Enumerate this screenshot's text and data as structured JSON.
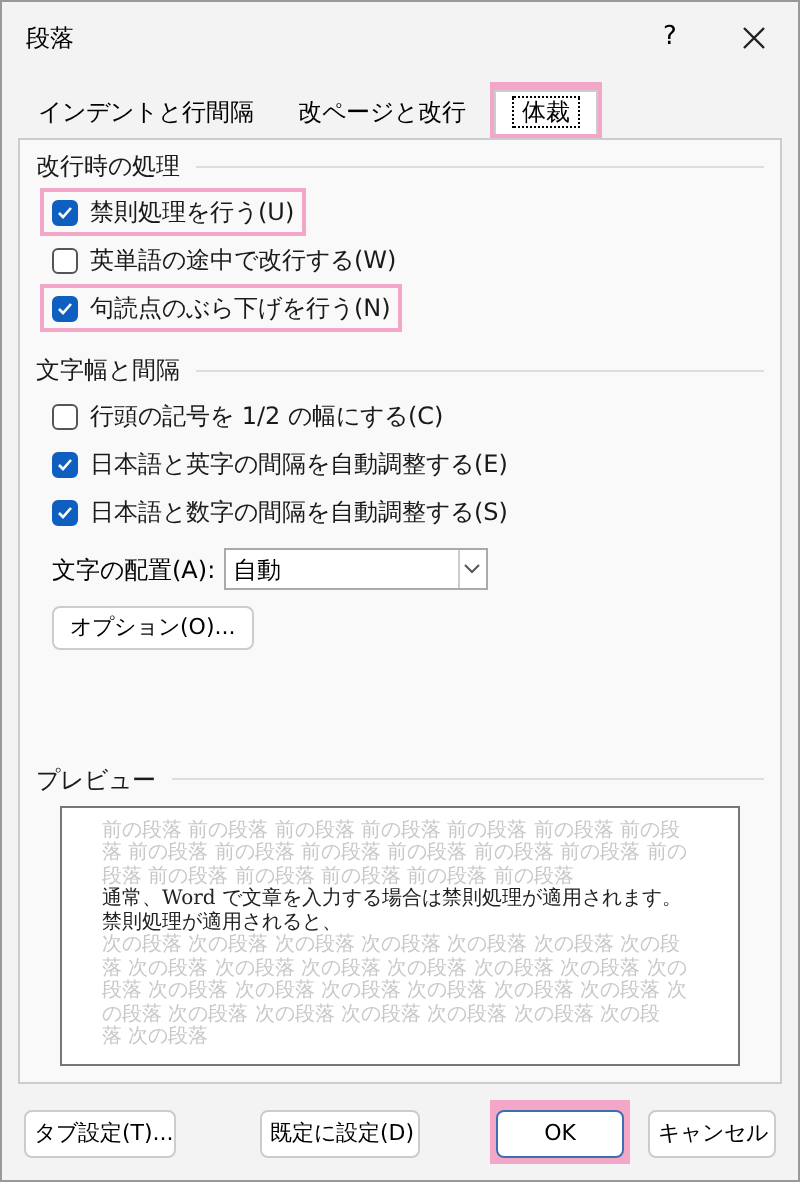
{
  "window": {
    "title": "段落",
    "help": "?"
  },
  "tabs": [
    {
      "label": "インデントと行間隔",
      "selected": false,
      "highlighted": false
    },
    {
      "label": "改ページと改行",
      "selected": false,
      "highlighted": false
    },
    {
      "label": "体裁",
      "selected": true,
      "highlighted": true
    }
  ],
  "sections": [
    {
      "title": "改行時の処理",
      "options": [
        {
          "label": "禁則処理を行う(U)",
          "checked": true,
          "highlighted": true
        },
        {
          "label": "英単語の途中で改行する(W)",
          "checked": false,
          "highlighted": false
        },
        {
          "label": "句読点のぶら下げを行う(N)",
          "checked": true,
          "highlighted": true
        }
      ]
    },
    {
      "title": "文字幅と間隔",
      "options": [
        {
          "label": "行頭の記号を 1/2 の幅にする(C)",
          "checked": false,
          "highlighted": false
        },
        {
          "label": "日本語と英字の間隔を自動調整する(E)",
          "checked": true,
          "highlighted": false
        },
        {
          "label": "日本語と数字の間隔を自動調整する(S)",
          "checked": true,
          "highlighted": false
        }
      ]
    }
  ],
  "alignment": {
    "label": "文字の配置(A):",
    "value": "自動"
  },
  "options_button": "オプション(O)...",
  "preview": {
    "title": "プレビュー",
    "previous_paragraph": "前の段落 前の段落 前の段落 前の段落 前の段落 前の段落 前の段落 前の段落 前の段落 前の段落 前の段落 前の段落 前の段落 前の段落 前の段落 前の段落 前の段落 前の段落 前の段落",
    "sample_text": "通常、Word で文章を入力する場合は禁則処理が適用されます。禁則処理が適用されると、",
    "next_paragraph": "次の段落 次の段落 次の段落 次の段落 次の段落 次の段落 次の段落 次の段落 次の段落 次の段落 次の段落 次の段落 次の段落 次の段落 次の段落 次の段落 次の段落 次の段落 次の段落 次の段落 次の段落 次の段落 次の段落 次の段落 次の段落 次の段落 次の段落 次の段落"
  },
  "buttons": [
    {
      "label": "タブ設定(T)...",
      "kind": "left",
      "highlighted": false
    },
    {
      "label": "既定に設定(D)",
      "kind": "middle",
      "highlighted": false
    },
    {
      "label": "OK",
      "kind": "primary",
      "highlighted": true
    },
    {
      "label": "キャンセル",
      "kind": "normal",
      "highlighted": false
    }
  ]
}
